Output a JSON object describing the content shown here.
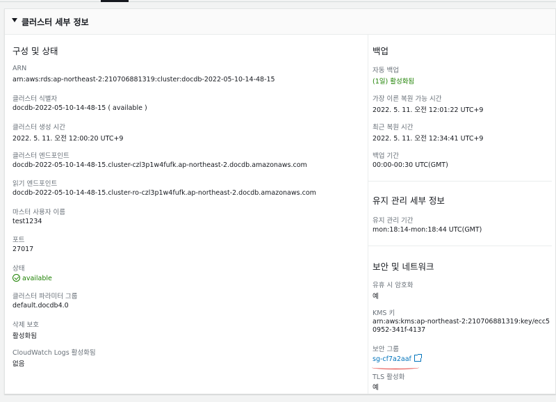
{
  "panel": {
    "title": "클러스터 세부 정보"
  },
  "config": {
    "title": "구성 및 상태",
    "fields": [
      {
        "label": "ARN",
        "value": "arn:aws:rds:ap-northeast-2:210706881319:cluster:docdb-2022-05-10-14-48-15"
      },
      {
        "label": "클러스터 식별자",
        "value": "docdb-2022-05-10-14-48-15 ( available )"
      },
      {
        "label": "클러스터 생성 시간",
        "value": "2022. 5. 11. 오전 12:00:20 UTC+9"
      },
      {
        "label": "클러스터 엔드포인트",
        "value": "docdb-2022-05-10-14-48-15.cluster-czl3p1w4fufk.ap-northeast-2.docdb.amazonaws.com"
      },
      {
        "label": "읽기 엔드포인트",
        "value": "docdb-2022-05-10-14-48-15.cluster-ro-czl3p1w4fufk.ap-northeast-2.docdb.amazonaws.com"
      },
      {
        "label": "마스터 사용자 이름",
        "value": "test1234"
      },
      {
        "label": "포트",
        "value": "27017"
      },
      {
        "label": "상태",
        "value": "available"
      },
      {
        "label": "클러스터 파라미터 그룹",
        "value": "default.docdb4.0"
      },
      {
        "label": "삭제 보호",
        "value": "활성화됨"
      },
      {
        "label": "CloudWatch Logs 활성화됨",
        "value": "없음"
      }
    ]
  },
  "backup": {
    "title": "백업",
    "fields": [
      {
        "label": "자동 백업",
        "value": "(1일) 활성화됨"
      },
      {
        "label": "가장 이른 복원 가능 시간",
        "value": "2022. 5. 11. 오전 12:01:22 UTC+9"
      },
      {
        "label": "최근 복원 시간",
        "value": "2022. 5. 11. 오전 12:34:41 UTC+9"
      },
      {
        "label": "백업 기간",
        "value": "00:00-00:30 UTC(GMT)"
      }
    ]
  },
  "maintenance": {
    "title": "유지 관리 세부 정보",
    "fields": [
      {
        "label": "유지 관리 기간",
        "value": "mon:18:14-mon:18:44 UTC(GMT)"
      }
    ]
  },
  "security": {
    "title": "보안 및 네트워크",
    "fields": [
      {
        "label": "유휴 시 암호화",
        "value": "예"
      },
      {
        "label": "KMS 키",
        "value": "arn:aws:kms:ap-northeast-2:210706881319:key/ecc50952-341f-4137"
      },
      {
        "label": "보안 그룹",
        "value": "sg-cf7a2aaf"
      },
      {
        "label": "TLS 활성화",
        "value": "예"
      }
    ]
  },
  "colors": {
    "status_green": "#1d8102",
    "link": "#0073bb",
    "annotation": "#e0201b"
  }
}
